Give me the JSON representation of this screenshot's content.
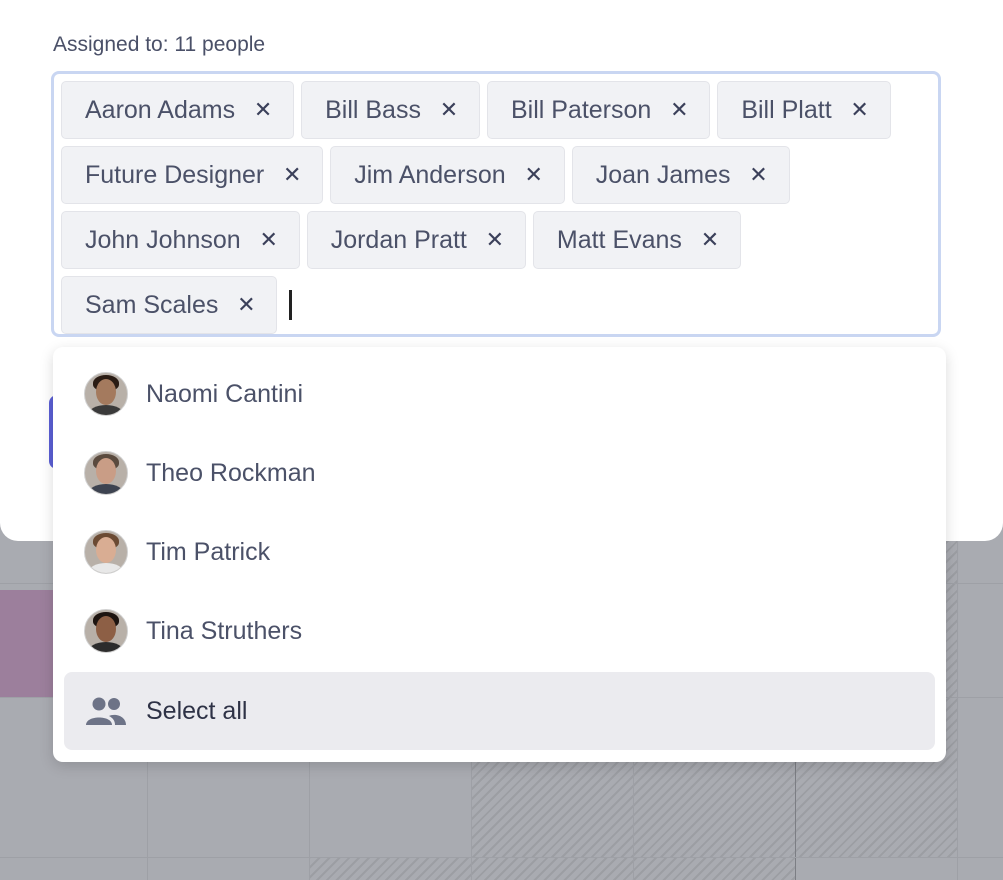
{
  "field": {
    "label": "Assigned to: 11 people"
  },
  "chips": [
    {
      "label": "Aaron Adams",
      "remove": "✕"
    },
    {
      "label": "Bill Bass",
      "remove": "✕"
    },
    {
      "label": "Bill Paterson",
      "remove": "✕"
    },
    {
      "label": "Bill Platt",
      "remove": "✕"
    },
    {
      "label": "Future Designer",
      "remove": "✕"
    },
    {
      "label": "Jim Anderson",
      "remove": "✕"
    },
    {
      "label": "Joan James",
      "remove": "✕"
    },
    {
      "label": "John Johnson",
      "remove": "✕"
    },
    {
      "label": "Jordan Pratt",
      "remove": "✕"
    },
    {
      "label": "Matt Evans",
      "remove": "✕"
    },
    {
      "label": "Sam Scales",
      "remove": "✕"
    }
  ],
  "dropdown": {
    "options": [
      {
        "label": "Naomi Cantini",
        "icon": "avatar",
        "skin": "#a47a5e",
        "hair": "#2a1c14",
        "shirt": "#3a3a3a"
      },
      {
        "label": "Theo Rockman",
        "icon": "avatar",
        "skin": "#c99d86",
        "hair": "#5a4a3e",
        "shirt": "#3d4350"
      },
      {
        "label": "Tim Patrick",
        "icon": "avatar",
        "skin": "#d9ad93",
        "hair": "#6b4a33",
        "shirt": "#e8e8e8"
      },
      {
        "label": "Tina Struthers",
        "icon": "avatar",
        "skin": "#8d5f45",
        "hair": "#1d1410",
        "shirt": "#2c2c2c"
      }
    ],
    "select_all": {
      "label": "Select all",
      "icon": "group-icon"
    }
  },
  "colors": {
    "accent": "#5b5fd6",
    "focus_border": "#c9d6f2",
    "event": "#9c7f9c"
  }
}
